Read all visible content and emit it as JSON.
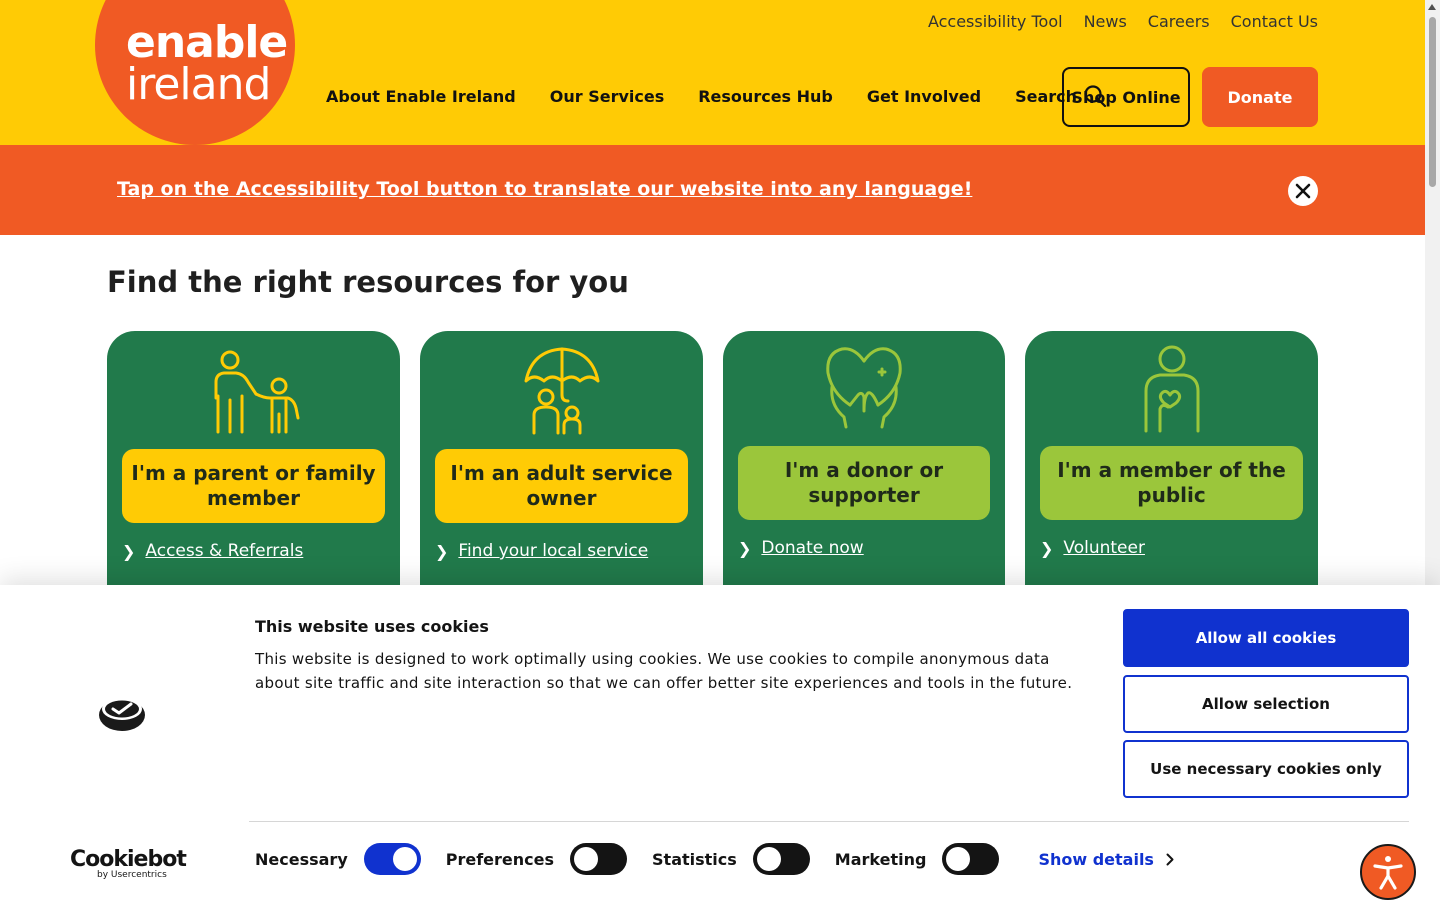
{
  "header": {
    "logo": {
      "line1": "enable",
      "line2": "ireland"
    },
    "utility_nav": [
      "Accessibility Tool",
      "News",
      "Careers",
      "Contact Us"
    ],
    "main_nav": [
      "About Enable Ireland",
      "Our Services",
      "Resources Hub",
      "Get Involved"
    ],
    "search_label": "Search",
    "shop_label": "Shop Online",
    "donate_label": "Donate"
  },
  "banner": {
    "text": "Tap on the Accessibility Tool button to translate our website into any language!"
  },
  "main": {
    "heading": "Find the right resources for you",
    "cards": [
      {
        "label": "I'm a parent or family member",
        "link": "Access & Referrals",
        "icon": "parent-child-icon"
      },
      {
        "label": "I'm an adult service owner",
        "link": "Find your local service",
        "icon": "umbrella-family-icon"
      },
      {
        "label": "I'm a donor or supporter",
        "link": "Donate now",
        "icon": "heart-hands-icon"
      },
      {
        "label": "I'm a member of the public",
        "link": "Volunteer",
        "icon": "person-heart-icon"
      }
    ]
  },
  "cookie": {
    "title": "This website uses cookies",
    "text": "This website is designed to work optimally using cookies. We use cookies to compile anonymous data about site traffic and site interaction so that we can offer better site experiences and tools in the future.",
    "allow_all": "Allow all cookies",
    "allow_selection": "Allow selection",
    "necessary_only": "Use necessary cookies only",
    "brand_name": "Cookiebot",
    "brand_by": "by Usercentrics",
    "toggles": [
      {
        "label": "Necessary",
        "on": true
      },
      {
        "label": "Preferences",
        "on": false
      },
      {
        "label": "Statistics",
        "on": false
      },
      {
        "label": "Marketing",
        "on": false
      }
    ],
    "show_details": "Show details"
  },
  "colors": {
    "header_yellow": "#ffcb05",
    "brand_orange": "#f05a24",
    "card_green": "#217a4b",
    "label_lime": "#9bc63b",
    "cookie_blue": "#1032cf"
  }
}
